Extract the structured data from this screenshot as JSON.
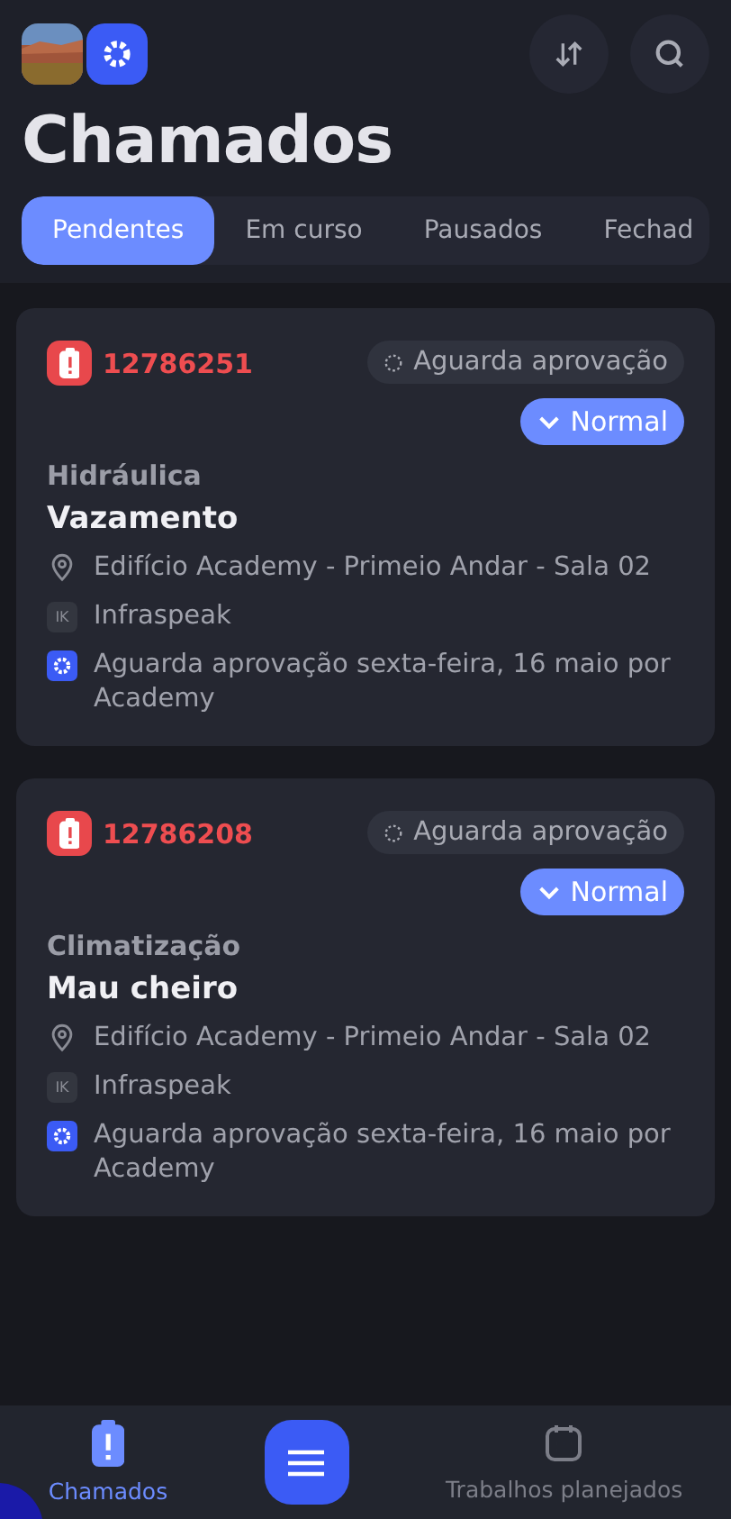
{
  "header": {
    "title": "Chamados"
  },
  "tabs": [
    {
      "label": "Pendentes",
      "selected": true
    },
    {
      "label": "Em curso",
      "selected": false
    },
    {
      "label": "Pausados",
      "selected": false
    },
    {
      "label": "Fechad",
      "selected": false
    }
  ],
  "tickets": [
    {
      "number": "12786251",
      "status": "Aguarda aprovação",
      "priority": "Normal",
      "category": "Hidráulica",
      "title": "Vazamento",
      "location": "Edifício Academy - Primeio Andar - Sala 02",
      "company_initials": "IK",
      "company": "Infraspeak",
      "note": "Aguarda aprovação sexta-feira, 16 maio por Academy"
    },
    {
      "number": "12786208",
      "status": "Aguarda aprovação",
      "priority": "Normal",
      "category": "Climatização",
      "title": "Mau cheiro",
      "location": "Edifício Academy - Primeio Andar - Sala 02",
      "company_initials": "IK",
      "company": "Infraspeak",
      "note": "Aguarda aprovação sexta-feira, 16 maio por Academy"
    }
  ],
  "bottom_nav": [
    {
      "kind": "tab",
      "label": "Chamados",
      "selected": true
    },
    {
      "kind": "menu"
    },
    {
      "kind": "tab",
      "label": "Trabalhos planejados",
      "selected": false
    }
  ]
}
